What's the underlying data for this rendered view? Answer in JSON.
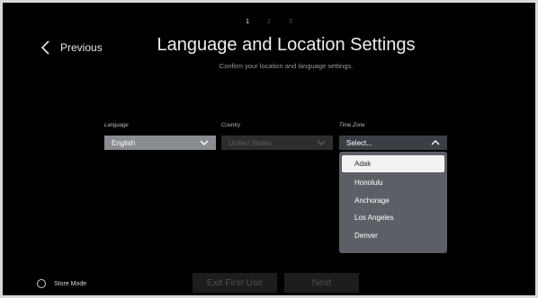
{
  "colors": {
    "background": "#000000",
    "language_select": "#898d91",
    "country_select": "#2d2d2d",
    "timezone_select": "#3b3f45",
    "dropdown": "#5c6066",
    "dropdown_selected": "#f3f3f3",
    "button_disabled": "#1d1d1d"
  },
  "steps": [
    "1",
    "2",
    "3"
  ],
  "active_step": "1",
  "header": {
    "back_label": "Previous",
    "back_icon": "chevron-left-icon",
    "title": "Language and Location Settings",
    "subtitle": "Confirm your location and language settings."
  },
  "fields": {
    "language": {
      "label": "Language",
      "value": "English",
      "icon": "chevron-down-icon"
    },
    "country": {
      "label": "Country",
      "value": "United States",
      "icon": "chevron-down-icon",
      "disabled": true
    },
    "timezone": {
      "label": "Time Zone",
      "value": "Select...",
      "icon": "chevron-up-icon",
      "expanded": true
    }
  },
  "timezone_options": [
    "Adak",
    "Honolulu",
    "Anchorage",
    "Los Angeles",
    "Denver"
  ],
  "timezone_selected_index": 0,
  "footer": {
    "store_mode_label": "Store Mode",
    "exit_label": "Exit First Use",
    "next_label": "Next"
  }
}
